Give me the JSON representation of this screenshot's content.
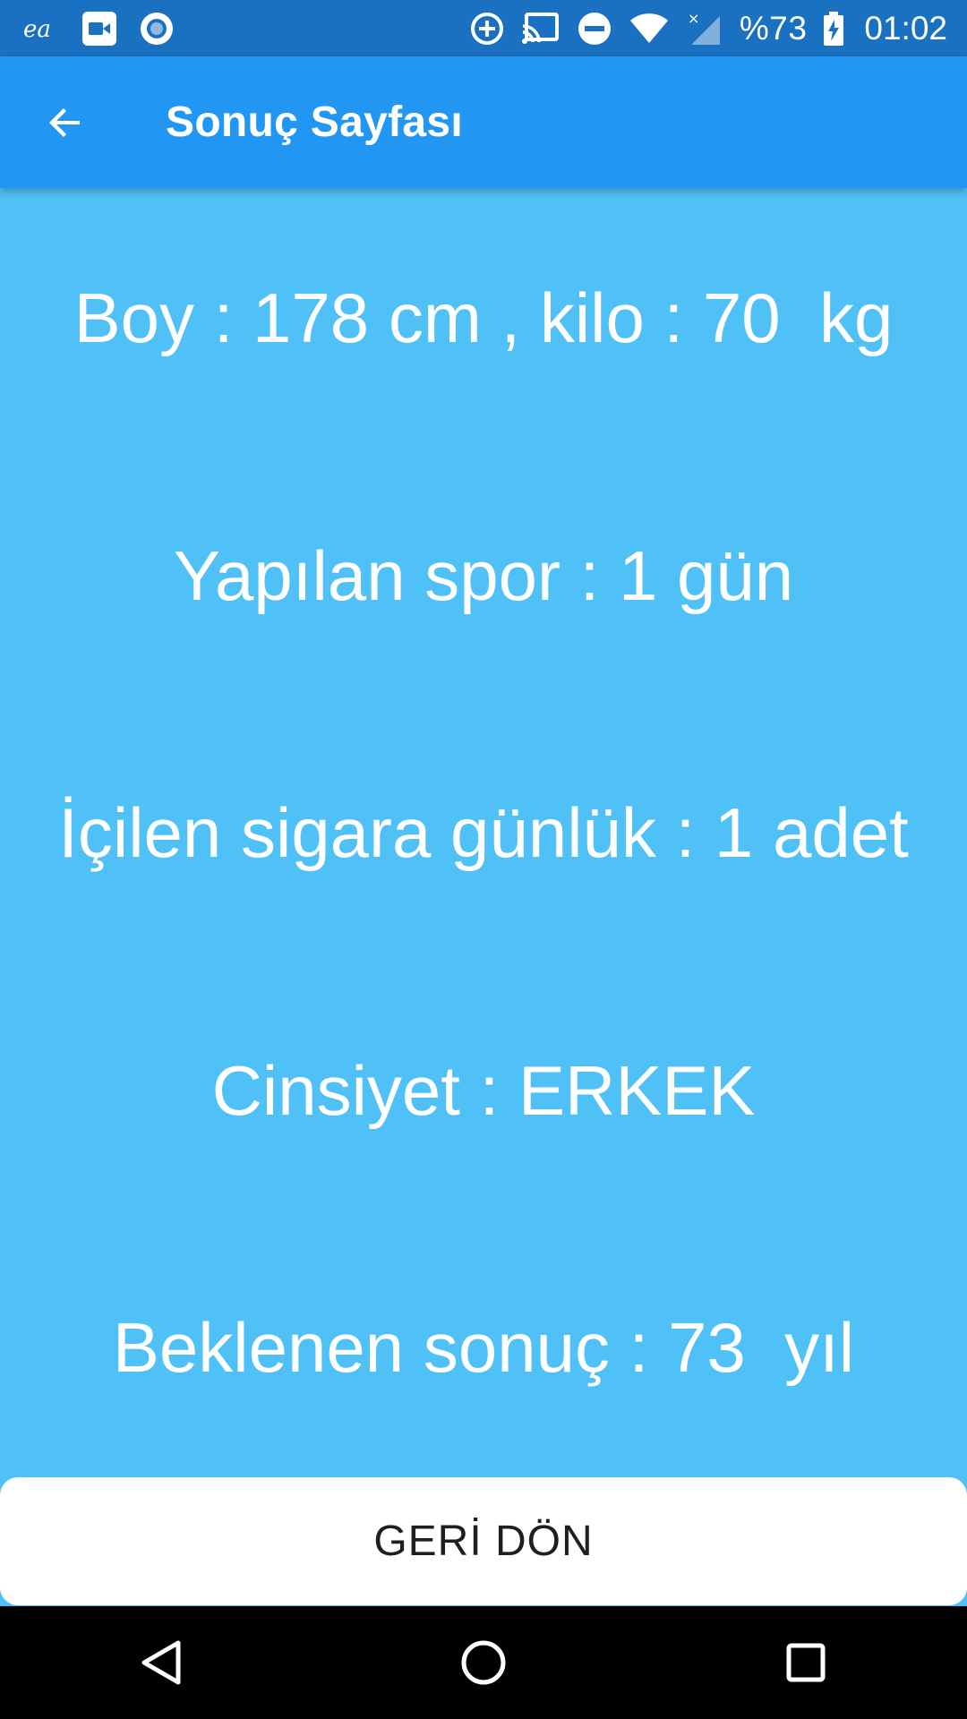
{
  "status_bar": {
    "battery_text": "%73",
    "time": "01:02",
    "icons": [
      "ea-icon",
      "video-icon",
      "record-icon",
      "data-saver-icon",
      "cast-icon",
      "dnd-icon",
      "wifi-icon",
      "signal-icon",
      "battery-icon"
    ]
  },
  "app_bar": {
    "title": "Sonuç Sayfası",
    "back_icon": "arrow-back-icon"
  },
  "results": {
    "boy_kilo": "Boy : 178 cm , kilo : 70  kg",
    "spor": "Yapılan spor : 1 gün",
    "sigara": "İçilen sigara günlük : 1 adet",
    "cinsiyet": "Cinsiyet : ERKEK",
    "sonuc": "Beklenen sonuç : 73  yıl"
  },
  "actions": {
    "back_button_label": "GERİ DÖN"
  },
  "nav_bar": {
    "icons": [
      "nav-back-icon",
      "nav-home-icon",
      "nav-recents-icon"
    ]
  },
  "colors": {
    "status_bar": "#1a70c1",
    "app_bar": "#2196f3",
    "background": "#4fc1f6",
    "button": "#ffffff",
    "nav_bar": "#000000"
  }
}
